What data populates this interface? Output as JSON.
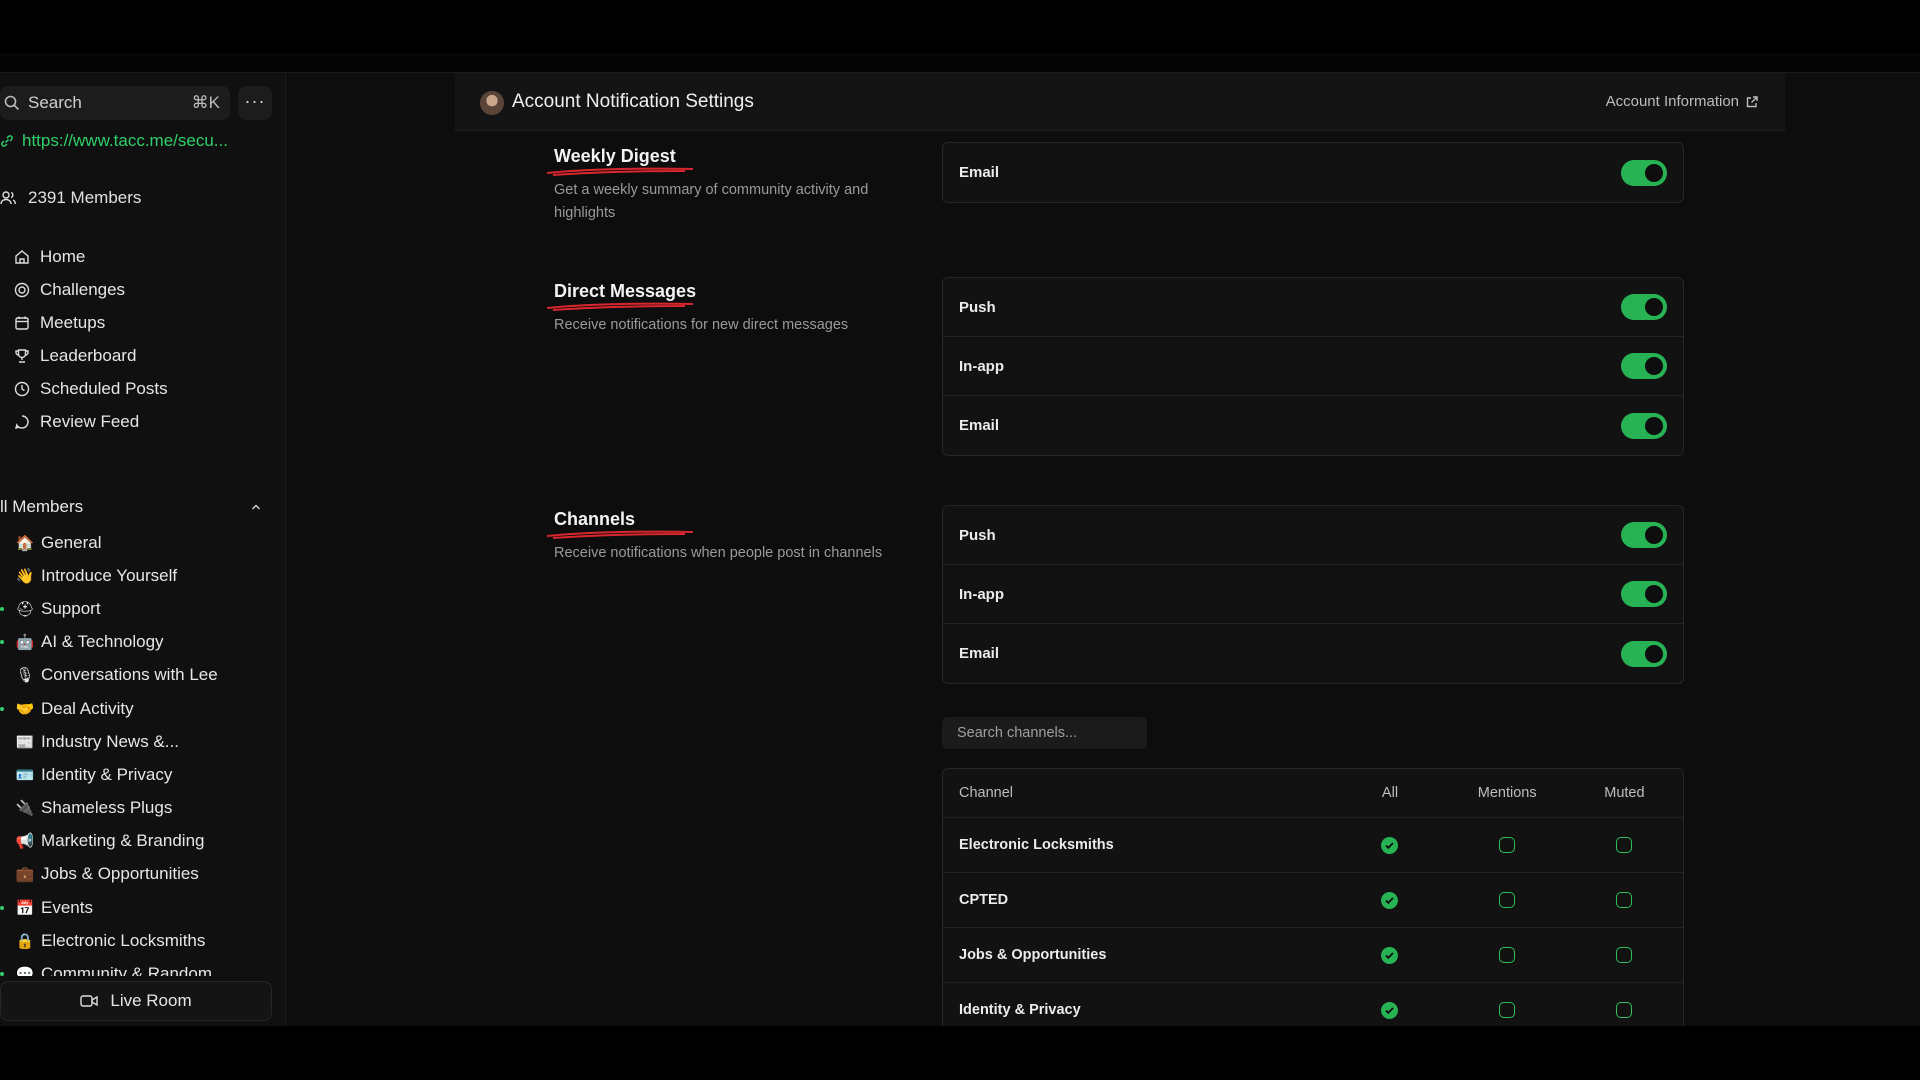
{
  "sidebar": {
    "search_label": "Search",
    "search_shortcut": "⌘K",
    "more_label": "···",
    "community_link": "https://www.tacc.me/secu...",
    "members_count": "2391 Members",
    "nav": [
      {
        "label": "Home",
        "icon": "home-icon"
      },
      {
        "label": "Challenges",
        "icon": "target-icon"
      },
      {
        "label": "Meetups",
        "icon": "calendar-icon"
      },
      {
        "label": "Leaderboard",
        "icon": "trophy-icon"
      },
      {
        "label": "Scheduled Posts",
        "icon": "clock-icon"
      },
      {
        "label": "Review Feed",
        "icon": "chat-icon"
      }
    ],
    "group_title": "ll Members",
    "channels": [
      {
        "emoji": "🏠",
        "label": "General",
        "dot": false
      },
      {
        "emoji": "👋",
        "label": "Introduce Yourself",
        "dot": false
      },
      {
        "emoji": "⛑",
        "label": "Support",
        "dot": true
      },
      {
        "emoji": "🤖",
        "label": "AI & Technology",
        "dot": true
      },
      {
        "emoji": "🎙",
        "label": "Conversations with Lee",
        "dot": false
      },
      {
        "emoji": "🤝",
        "label": "Deal Activity",
        "dot": true
      },
      {
        "emoji": "📰",
        "label": "Industry News &...",
        "dot": false
      },
      {
        "emoji": "🪪",
        "label": "Identity & Privacy",
        "dot": false
      },
      {
        "emoji": "🔌",
        "label": "Shameless Plugs",
        "dot": false
      },
      {
        "emoji": "📢",
        "label": "Marketing & Branding",
        "dot": false
      },
      {
        "emoji": "💼",
        "label": "Jobs & Opportunities",
        "dot": false
      },
      {
        "emoji": "📅",
        "label": "Events",
        "dot": true
      },
      {
        "emoji": "🔒",
        "label": "Electronic Locksmiths",
        "dot": false
      },
      {
        "emoji": "💬",
        "label": "Community & Random",
        "dot": true
      }
    ],
    "live_room": "Live Room"
  },
  "header": {
    "title": "Account Notification Settings",
    "account_link": "Account Information"
  },
  "sections": {
    "weekly": {
      "title": "Weekly Digest",
      "desc_line1": "Get a weekly summary of community activity and",
      "desc_line2": "highlights",
      "rows": [
        {
          "label": "Email",
          "on": true
        }
      ]
    },
    "direct": {
      "title": "Direct Messages",
      "desc": "Receive notifications for new direct messages",
      "rows": [
        {
          "label": "Push",
          "on": true
        },
        {
          "label": "In-app",
          "on": true
        },
        {
          "label": "Email",
          "on": true
        }
      ]
    },
    "channels": {
      "title": "Channels",
      "desc": "Receive notifications when people post in channels",
      "rows": [
        {
          "label": "Push",
          "on": true
        },
        {
          "label": "In-app",
          "on": true
        },
        {
          "label": "Email",
          "on": true
        }
      ]
    }
  },
  "channel_table": {
    "search_placeholder": "Search channels...",
    "headers": {
      "name": "Channel",
      "all": "All",
      "mentions": "Mentions",
      "muted": "Muted"
    },
    "rows": [
      {
        "name": "Electronic Locksmiths",
        "setting": "All"
      },
      {
        "name": "CPTED",
        "setting": "All"
      },
      {
        "name": "Jobs & Opportunities",
        "setting": "All"
      },
      {
        "name": "Identity & Privacy",
        "setting": "All"
      }
    ]
  },
  "colors": {
    "accent": "#27b254",
    "link": "#2fd06a",
    "underline": "#d8262e"
  }
}
